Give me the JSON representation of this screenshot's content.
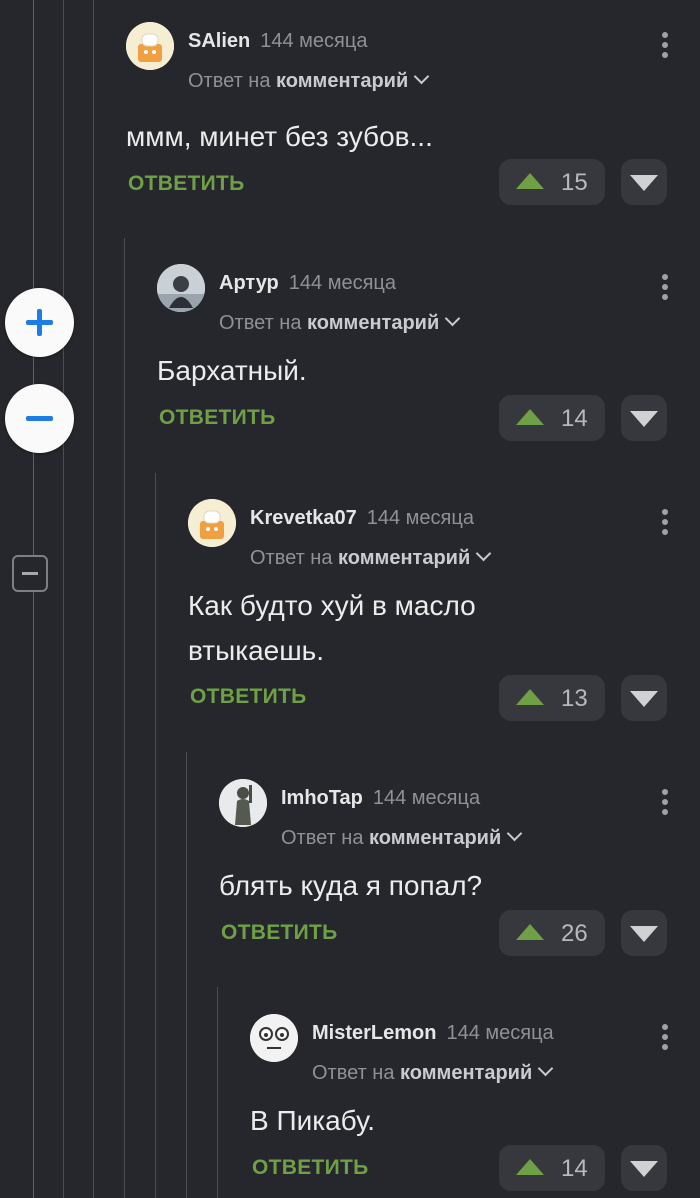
{
  "comments": [
    {
      "author": "SAlien",
      "time": "144 месяца",
      "reply_prefix": "Ответ на",
      "reply_target": "комментарий",
      "text": "ммм, минет без зубов...",
      "reply_label": "ОТВЕТИТЬ",
      "votes": "15"
    },
    {
      "author": "Артур",
      "time": "144 месяца",
      "reply_prefix": "Ответ на",
      "reply_target": "комментарий",
      "text": "Бархатный.",
      "reply_label": "ОТВЕТИТЬ",
      "votes": "14"
    },
    {
      "author": "Krevetka07",
      "time": "144 месяца",
      "reply_prefix": "Ответ на",
      "reply_target": "комментарий",
      "text": "Как будто хуй в масло\nвтыкаешь.",
      "reply_label": "ОТВЕТИТЬ",
      "votes": "13"
    },
    {
      "author": "ImhoTap",
      "time": "144 месяца",
      "reply_prefix": "Ответ на",
      "reply_target": "комментарий",
      "text": "блять куда я попал?",
      "reply_label": "ОТВЕТИТЬ",
      "votes": "26"
    },
    {
      "author": "MisterLemon",
      "time": "144 месяца",
      "reply_prefix": "Ответ на",
      "reply_target": "комментарий",
      "text": "В Пикабу.",
      "reply_label": "ОТВЕТИТЬ",
      "votes": "14"
    }
  ],
  "icons": {
    "zoom_in": "plus-icon",
    "zoom_out": "minus-icon",
    "collapse": "collapse-icon",
    "more": "more-vertical-icon",
    "upvote": "arrow-up-icon",
    "downvote": "arrow-down-icon",
    "dropdown": "chevron-down-icon"
  },
  "colors": {
    "background": "#25272c",
    "accent_green": "#6fa046",
    "zoom_blue": "#1e7de3",
    "button_bg": "#36383d"
  }
}
